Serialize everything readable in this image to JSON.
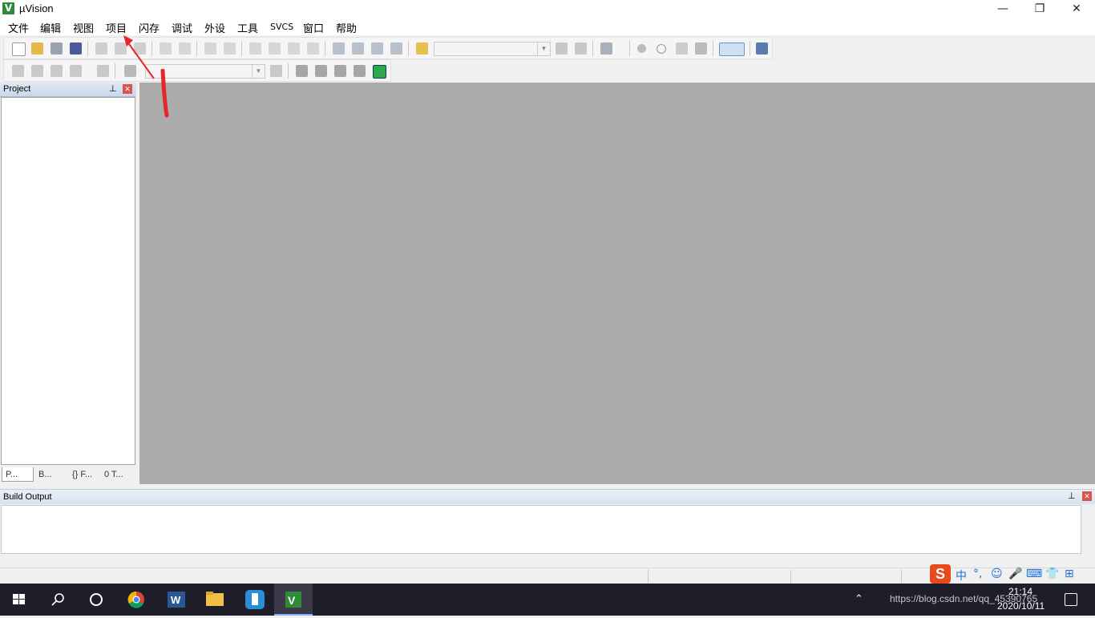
{
  "window": {
    "title": "µVision",
    "app_icon_glyph": "V",
    "minimize": "—",
    "restore": "❐",
    "close": "✕"
  },
  "menu": [
    "文件",
    "编辑",
    "视图",
    "项目",
    "闪存",
    "调试",
    "外设",
    "工具",
    "SVCS",
    "窗口",
    "帮助"
  ],
  "project_panel": {
    "title": "Project",
    "tabs": [
      "P...",
      "B...",
      "{} F...",
      "0 T..."
    ]
  },
  "build_output": {
    "title": "Build Output"
  },
  "ime": {
    "logo": "S",
    "items": [
      "中",
      "°,",
      "☺",
      "🎤",
      "⌨",
      "👕",
      "⊞"
    ]
  },
  "taskbar": {
    "tray_text": "https://blog.csdn.net/qq_45390765",
    "time": "21:14",
    "date": "2020/10/11"
  },
  "colors": {
    "annotation": "#e8262a",
    "editor_bg": "#ababab",
    "taskbar_bg": "#1e1e2a"
  }
}
